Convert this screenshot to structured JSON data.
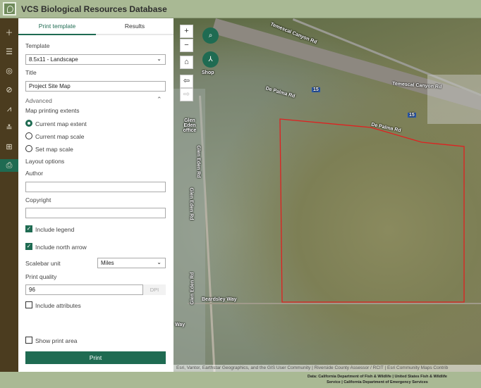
{
  "app": {
    "title": "VCS Biological Resources Database"
  },
  "sidebar": {
    "items": [
      {
        "icon": "add-icon"
      },
      {
        "icon": "layer-list-icon"
      },
      {
        "icon": "basemap-icon"
      },
      {
        "icon": "analysis-icon"
      },
      {
        "icon": "chart-icon"
      },
      {
        "icon": "measure-icon"
      },
      {
        "icon": "grid-icon"
      },
      {
        "icon": "print-icon",
        "active": true
      }
    ]
  },
  "panel": {
    "tabs": [
      {
        "label": "Print template"
      },
      {
        "label": "Results"
      }
    ],
    "template_label": "Template",
    "template_value": "8.5x11 - Landscape",
    "title_label": "Title",
    "title_value": "Project Site Map",
    "advanced_label": "Advanced",
    "extents_label": "Map printing extents",
    "extents": [
      {
        "label": "Current map extent",
        "checked": true
      },
      {
        "label": "Current map scale",
        "checked": false
      },
      {
        "label": "Set map scale",
        "checked": false
      }
    ],
    "layout_label": "Layout options",
    "author_label": "Author",
    "author_value": "",
    "copyright_label": "Copyright",
    "copyright_value": "",
    "include_legend": "Include legend",
    "include_north": "Include north arrow",
    "scalebar_label": "Scalebar unit",
    "scalebar_value": "Miles",
    "quality_label": "Print quality",
    "quality_value": "96",
    "dpi": "DPI",
    "include_attributes": "Include attributes",
    "show_print_area": "Show print area",
    "print_button": "Print"
  },
  "map": {
    "labels": {
      "temescal1": "Temescal Canyon Rd",
      "temescal2": "Temescal Canyon Rd",
      "depalma1": "De Palma Rd",
      "depalma2": "De Palma Rd",
      "shop": "Shop",
      "glen_office": "Glen Eden office",
      "glen_rd1": "Glen Eden Rd",
      "glen_rd2": "Glen Eden Rd",
      "glen_rd3": "Glen Eden Rd",
      "beardsley": "Beardsley Way",
      "way": "Way",
      "i15a": "15",
      "i15b": "15"
    },
    "attribution": "Esri, Vantor, Earthstar Geographics, and the GIS User Community | Riverside County Assessor / RCIT | Esri Community Maps Contrib",
    "site_boundary_color": "#e02020"
  },
  "footer": {
    "line1": "Data: California Department of Fish & Wildlife | United States Fish & Wildlife",
    "line2": "Service | California Department of Emergency Services"
  }
}
